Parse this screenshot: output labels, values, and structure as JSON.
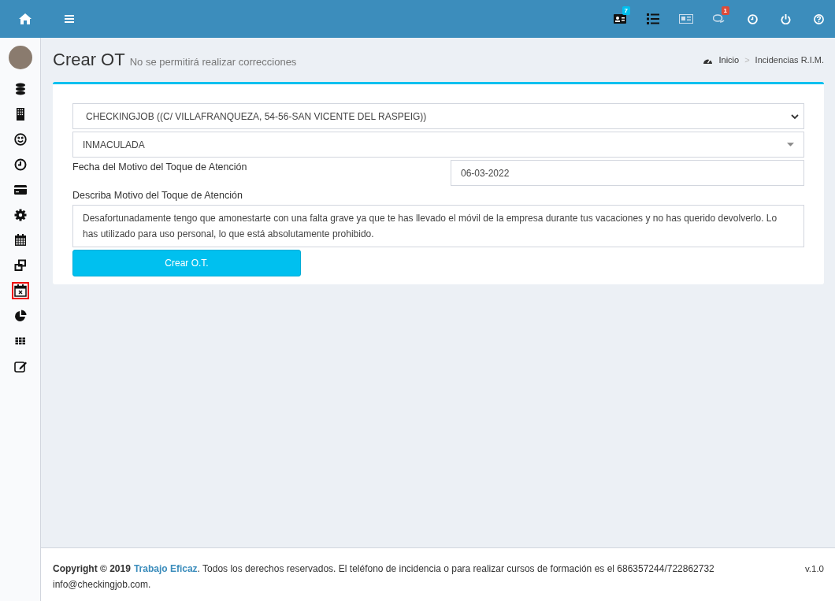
{
  "topbar": {
    "left": [
      {
        "kind": "home"
      },
      {
        "kind": "menu"
      }
    ],
    "right": [
      {
        "kind": "contact-card",
        "badge": "7",
        "color": "#00c0ef"
      },
      {
        "kind": "list"
      },
      {
        "kind": "newspaper"
      },
      {
        "kind": "chat",
        "badge": "1",
        "color": "#dd4b39"
      },
      {
        "kind": "clock"
      },
      {
        "kind": "power"
      },
      {
        "kind": "help"
      }
    ]
  },
  "sidebar": {
    "items": [
      {
        "kind": "database",
        "selected": false
      },
      {
        "kind": "building",
        "selected": false
      },
      {
        "kind": "smile",
        "selected": false
      },
      {
        "kind": "clock",
        "selected": false
      },
      {
        "kind": "card",
        "selected": false
      },
      {
        "kind": "gear",
        "selected": false
      },
      {
        "kind": "calendar",
        "selected": false
      },
      {
        "kind": "windows",
        "selected": false
      },
      {
        "kind": "calendar-x",
        "selected": true
      },
      {
        "kind": "pie",
        "selected": false
      },
      {
        "kind": "grid",
        "selected": false
      },
      {
        "kind": "edit",
        "selected": false
      }
    ]
  },
  "header": {
    "title": "Crear OT",
    "subtitle": "No se permitirá realizar correcciones",
    "breadcrumb": [
      "Inicio",
      "Incidencias R.I.M."
    ],
    "breadcrumb_separator": ">"
  },
  "form": {
    "company_select": "CHECKINGJOB ((C/ VILLAFRANQUEZA, 54-56-SAN VICENTE DEL RASPEIG))",
    "person_select": "INMACULADA",
    "date_label": "Fecha del Motivo del Toque de Atención",
    "date_value": "06-03-2022",
    "reason_label": "Describa Motivo del Toque de Atención",
    "reason_value": "Desafortunadamente tengo que amonestarte con una falta grave ya que te has llevado el móvil de la empresa durante tus vacaciones y no has querido devolverlo. Lo has utilizado para uso personal, lo que está absolutamente prohibido.",
    "submit": "Crear O.T."
  },
  "footer": {
    "copyright": "Copyright © 2019",
    "link": "Trabajo Eficaz",
    "text": ". Todos los derechos reservados. El teléfono de incidencia o para realizar cursos de formación es el 686357244/722862732 info@checkingjob.com.",
    "version": "v.1.0"
  }
}
